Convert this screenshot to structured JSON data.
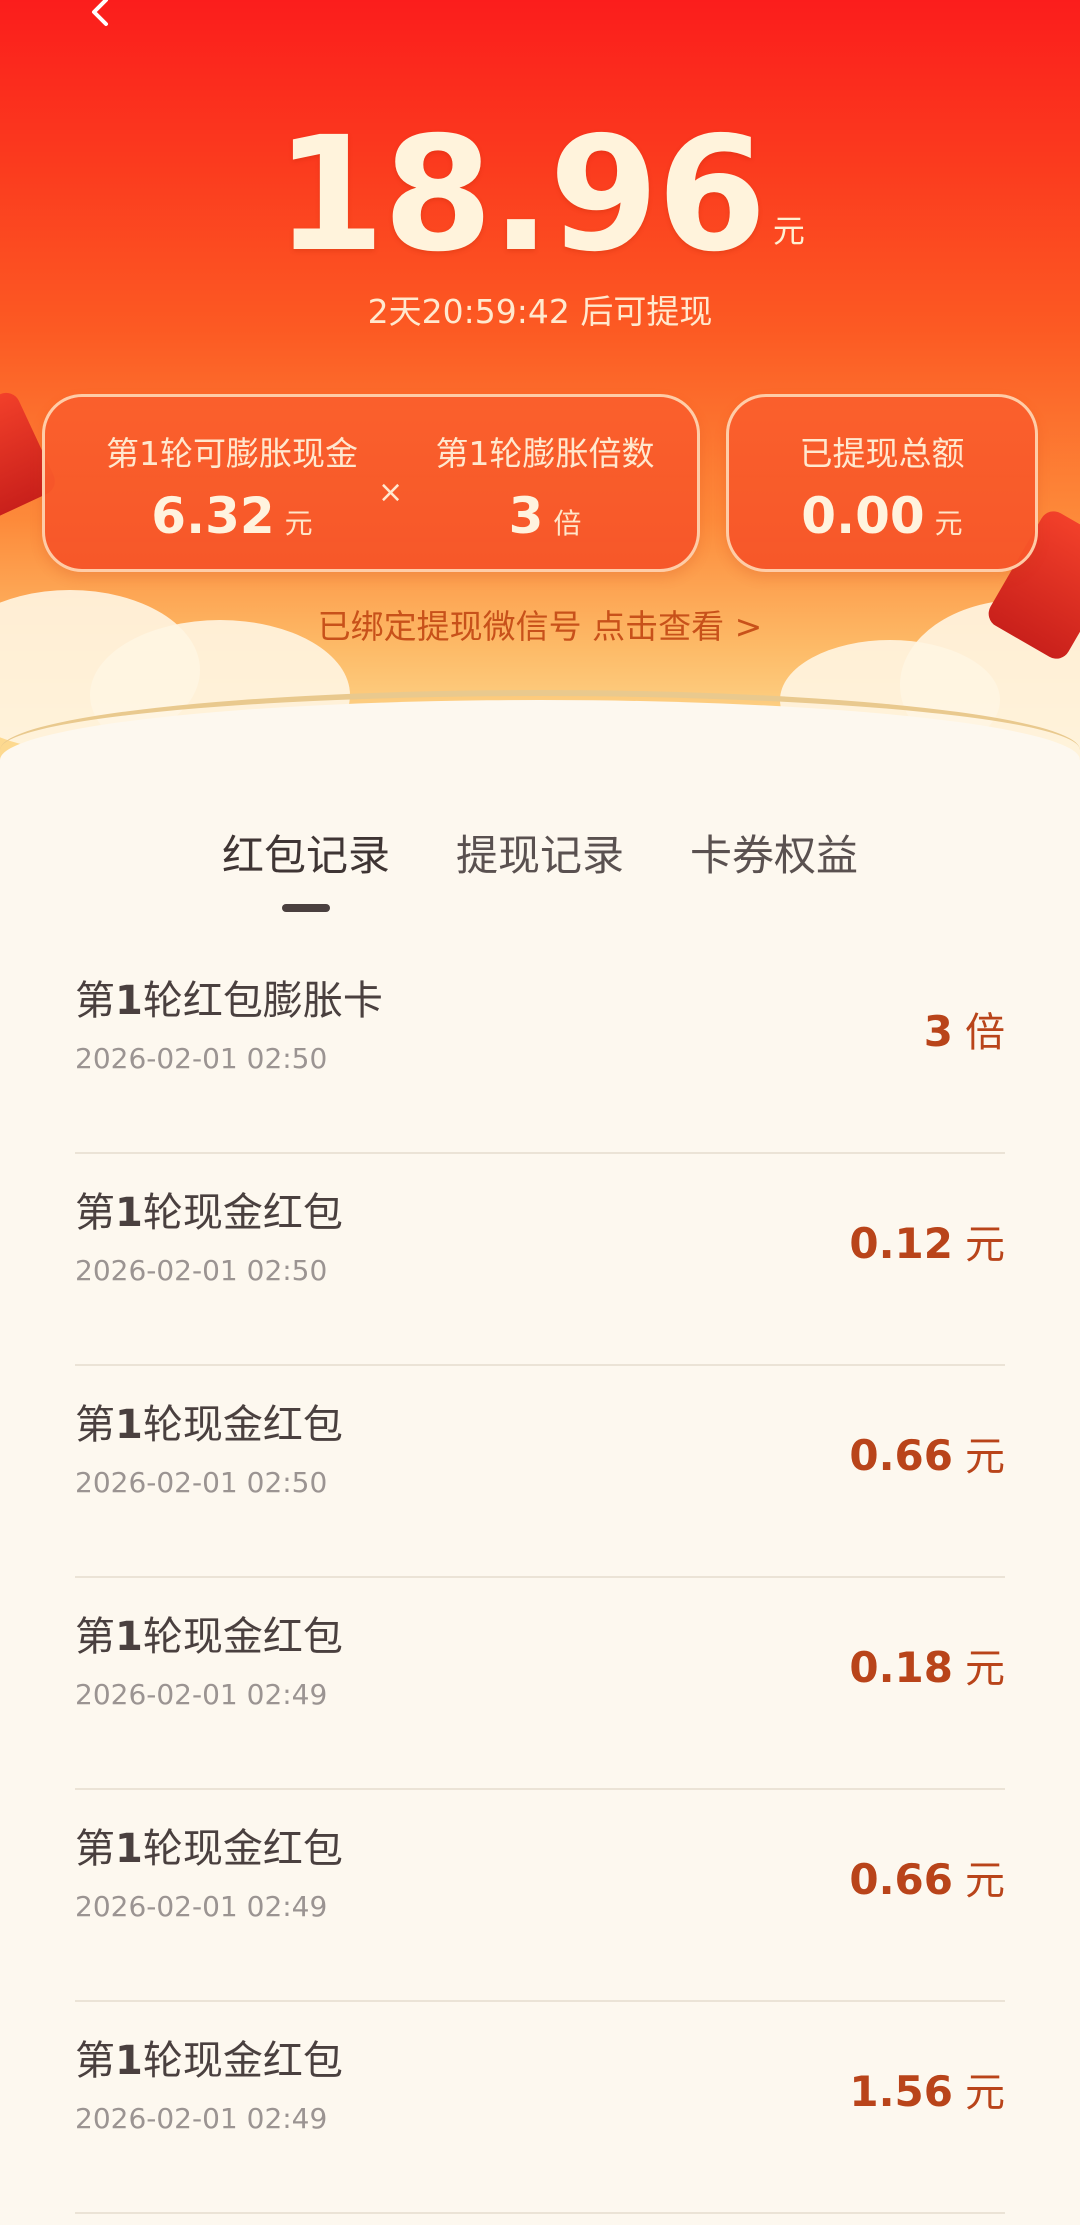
{
  "header": {
    "amount": "18.96",
    "amount_unit": "元",
    "countdown": "2天20:59:42 后可提现",
    "bind_link": "已绑定提现微信号 点击查看 >",
    "colors": {
      "top": "#fb1d1c",
      "accent": "#b9441a"
    }
  },
  "stats": {
    "expandable_label": "第1轮可膨胀现金",
    "expandable_value": "6.32",
    "expandable_unit": "元",
    "times_symbol": "×",
    "multiplier_label": "第1轮膨胀倍数",
    "multiplier_value": "3",
    "multiplier_unit": "倍",
    "withdrawn_label": "已提现总额",
    "withdrawn_value": "0.00",
    "withdrawn_unit": "元"
  },
  "tabs": [
    {
      "label": "红包记录",
      "active": true
    },
    {
      "label": "提现记录",
      "active": false
    },
    {
      "label": "卡券权益",
      "active": false
    }
  ],
  "records": [
    {
      "title_pre": "第",
      "title_num": "1",
      "title_post": "轮红包膨胀卡",
      "time": "2026-02-01 02:50",
      "value": "3",
      "unit": "倍"
    },
    {
      "title_pre": "第",
      "title_num": "1",
      "title_post": "轮现金红包",
      "time": "2026-02-01 02:50",
      "value": "0.12",
      "unit": "元"
    },
    {
      "title_pre": "第",
      "title_num": "1",
      "title_post": "轮现金红包",
      "time": "2026-02-01 02:50",
      "value": "0.66",
      "unit": "元"
    },
    {
      "title_pre": "第",
      "title_num": "1",
      "title_post": "轮现金红包",
      "time": "2026-02-01 02:49",
      "value": "0.18",
      "unit": "元"
    },
    {
      "title_pre": "第",
      "title_num": "1",
      "title_post": "轮现金红包",
      "time": "2026-02-01 02:49",
      "value": "0.66",
      "unit": "元"
    },
    {
      "title_pre": "第",
      "title_num": "1",
      "title_post": "轮现金红包",
      "time": "2026-02-01 02:49",
      "value": "1.56",
      "unit": "元"
    }
  ]
}
